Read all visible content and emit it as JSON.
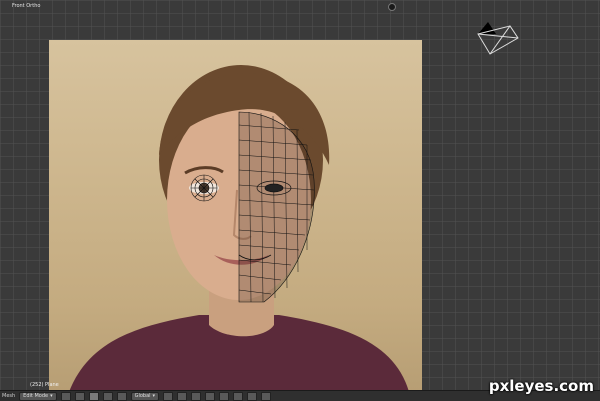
{
  "viewport": {
    "view_label": "Front Ortho",
    "object_info": "(252) Plane"
  },
  "statusbar": {
    "menu_label": "Mesh",
    "mode": "Edit Mode",
    "orientation": "Global"
  },
  "watermark": "pxleyes.com",
  "colors": {
    "background": "#3a3a3a",
    "grid": "#505050",
    "wire": "#111111",
    "shirt": "#5b2a3a"
  }
}
